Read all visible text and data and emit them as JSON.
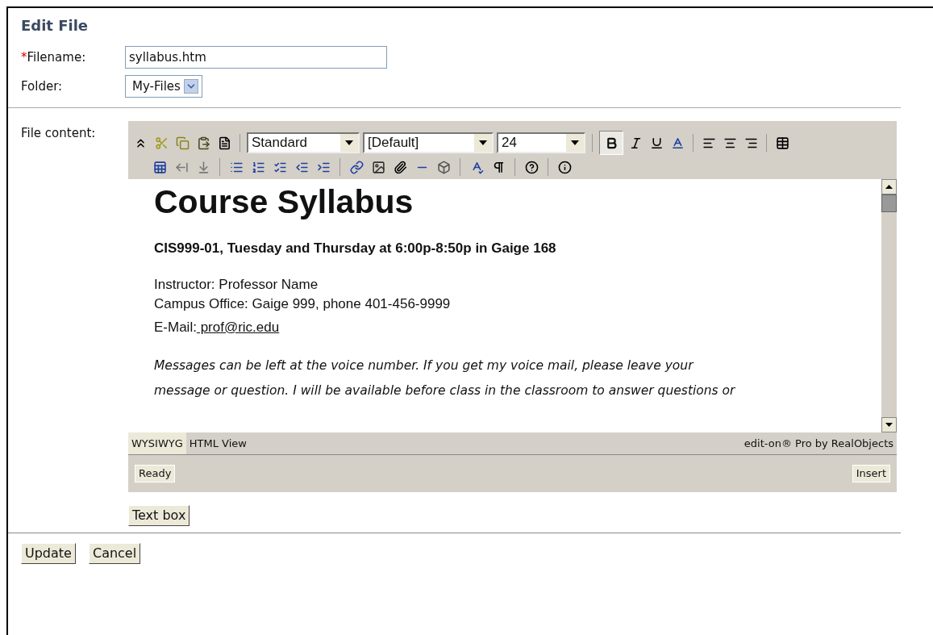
{
  "title": "Edit File",
  "fields": [
    {
      "required_mark": "*",
      "label": "Filename:",
      "kind": "text",
      "value": "syllabus.htm"
    },
    {
      "label": "Folder:",
      "kind": "select",
      "value": "My-Files"
    }
  ],
  "content_label": "File content:",
  "toolbar": {
    "style": "Standard",
    "font": "[Default]",
    "size": "24",
    "bold_on": true
  },
  "document": {
    "heading": "Course Syllabus",
    "subheading": "CIS999-01, Tuesday and Thursday at 6:00p-8:50p in Gaige 168",
    "lines": [
      "Instructor: Professor Name",
      "Campus Office: Gaige 999, phone 401-456-9999"
    ],
    "email_label": "E-Mail:",
    "email_link": " prof@ric.edu",
    "paragraph_lines": [
      "Messages can be left at the voice number. If you get my voice mail, please leave your",
      "message or question. I will be available before class in the classroom to answer questions or"
    ]
  },
  "view_tabs": [
    {
      "label": "WYSIWYG",
      "selected": true
    },
    {
      "label": "HTML View",
      "selected": false
    }
  ],
  "credit": "edit-on® Pro by RealObjects",
  "status": {
    "left": "Ready",
    "right": "Insert"
  },
  "text_box_button": "Text box",
  "buttons": [
    "Update",
    "Cancel"
  ]
}
